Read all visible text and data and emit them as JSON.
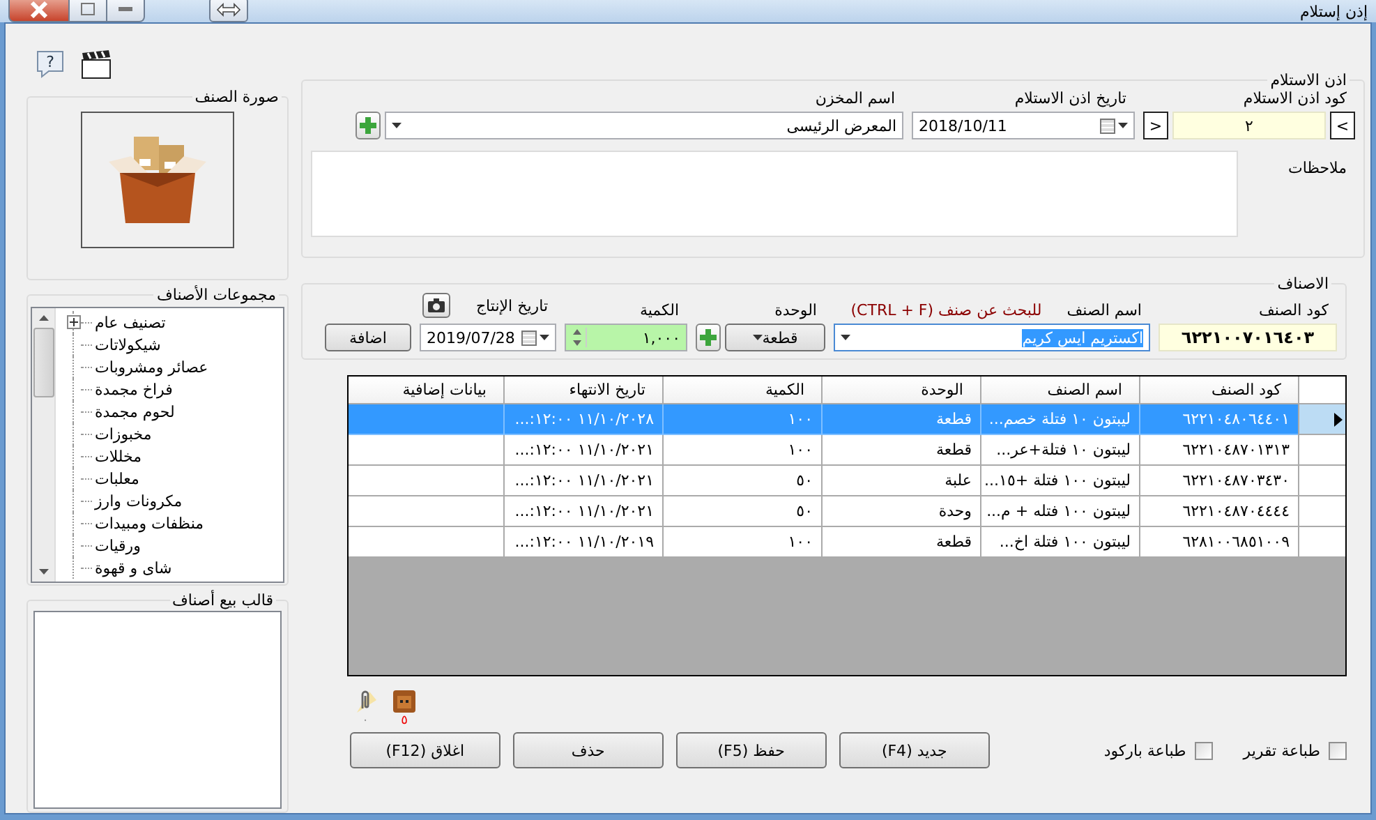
{
  "window": {
    "title": "إذن إستلام"
  },
  "help": "?",
  "receipt": {
    "legend": "اذن الاستلام",
    "code_label": "كود اذن الاستلام",
    "code": "٢",
    "prev": "<",
    "next": ">",
    "date_label": "تاريخ اذن الاستلام",
    "date": "2018/10/11",
    "store_label": "اسم المخزن",
    "store": "المعرض الرئيسى",
    "notes_label": "ملاحظات"
  },
  "picture": {
    "legend": "صورة الصنف"
  },
  "categories": {
    "legend": "مجموعات الأصناف",
    "items": [
      {
        "label": "تصنيف عام",
        "expandable": true
      },
      {
        "label": "شيكولاتات",
        "expandable": false
      },
      {
        "label": "عصائر ومشروبات",
        "expandable": false
      },
      {
        "label": "فراخ مجمدة",
        "expandable": false
      },
      {
        "label": "لحوم مجمدة",
        "expandable": false
      },
      {
        "label": "مخبوزات",
        "expandable": false
      },
      {
        "label": "مخللات",
        "expandable": false
      },
      {
        "label": "معلبات",
        "expandable": false
      },
      {
        "label": "مكرونات وارز",
        "expandable": false
      },
      {
        "label": "منظفات ومبيدات",
        "expandable": false
      },
      {
        "label": "ورقيات",
        "expandable": false
      },
      {
        "label": "شاى و قهوة",
        "expandable": false
      }
    ]
  },
  "sale_template": {
    "legend": "قالب بيع أصناف"
  },
  "item_entry": {
    "legend": "الاصناف",
    "code_label": "كود الصنف",
    "code": "٦٢٢١٠٠٧٠١٦٤٠٣",
    "name_label": "اسم الصنف",
    "search_hint": "للبحث عن صنف (CTRL + F)",
    "name": "اكستريم ايس كريم",
    "unit_label": "الوحدة",
    "unit": "قطعة",
    "qty_label": "الكمية",
    "qty": "١,٠٠٠",
    "prod_date_label": "تاريخ الإنتاج",
    "prod_date": "2019/07/28",
    "add_button": "اضافة"
  },
  "grid": {
    "columns": [
      "كود الصنف",
      "اسم الصنف",
      "الوحدة",
      "الكمية",
      "تاريخ الانتهاء",
      "بيانات إضافية"
    ],
    "rows": [
      {
        "selected": true,
        "cells": [
          "٦٢٢١٠٤٨٠٦٤٤٠١",
          "ليبتون ١٠ فتلة خصم...",
          "قطعة",
          "١٠٠",
          "١١/١٠/٢٠٢٨ ١٢:٠٠:..."
        ]
      },
      {
        "selected": false,
        "cells": [
          "٦٢٢١٠٤٨٧٠١٣١٣",
          "ليبتون ١٠ فتلة+عر...",
          "قطعة",
          "١٠٠",
          "١١/١٠/٢٠٢١ ١٢:٠٠:..."
        ]
      },
      {
        "selected": false,
        "cells": [
          "٦٢٢١٠٤٨٧٠٣٤٣٠",
          "ليبتون ١٠٠ فتلة +١٥...",
          "علبة",
          "٥٠",
          "١١/١٠/٢٠٢١ ١٢:٠٠:..."
        ]
      },
      {
        "selected": false,
        "cells": [
          "٦٢٢١٠٤٨٧٠٤٤٤٤",
          "ليبتون ١٠٠ فتله + م...",
          "وحدة",
          "٥٠",
          "١١/١٠/٢٠٢١ ١٢:٠٠:..."
        ]
      },
      {
        "selected": false,
        "cells": [
          "٦٢٨١٠٠٦٨٥١٠٠٩",
          "ليبتون  ١٠٠ فتلة اخ...",
          "قطعة",
          "١٠٠",
          "١١/١٠/٢٠١٩ ١٢:٠٠:..."
        ]
      }
    ]
  },
  "attachments": {
    "clip_count": "٠",
    "box_count": "٥"
  },
  "options": [
    {
      "label": "طباعة تقرير",
      "checked": false
    },
    {
      "label": "طباعة باركود",
      "checked": false
    }
  ],
  "buttons": [
    "جديد (F4)",
    "حفظ (F5)",
    "حذف",
    "اغلاق (F12)"
  ]
}
